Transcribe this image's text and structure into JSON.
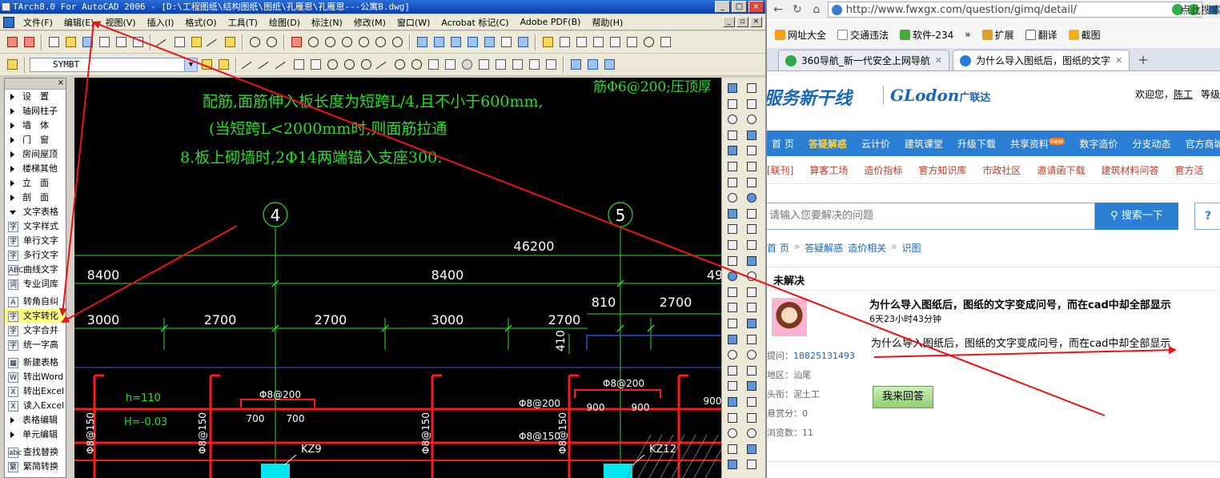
{
  "cad": {
    "title": "TArch8.0 For AutoCAD 2006 - [D:\\工程图纸\\结构图纸\\图纸\\孔雁恩\\孔雁恩---公寓B.dwg]",
    "window_buttons": [
      "_",
      "□",
      "×"
    ],
    "mdi_buttons": [
      "_",
      "▫",
      "×"
    ],
    "menu": [
      "文件(F)",
      "编辑(E)",
      "视图(V)",
      "插入(I)",
      "格式(O)",
      "工具(T)",
      "绘图(D)",
      "标注(N)",
      "修改(M)",
      "窗口(W)",
      "Acrobat 标记(C)",
      "Adobe PDF(B)",
      "帮助(H)"
    ],
    "layer_value": "SYMBT",
    "sidebar_close": "×",
    "sidebar_items": [
      {
        "label": "设　置",
        "kind": "group"
      },
      {
        "label": "轴网柱子",
        "kind": "group"
      },
      {
        "label": "墙　体",
        "kind": "group"
      },
      {
        "label": "门　窗",
        "kind": "group"
      },
      {
        "label": "房间屋顶",
        "kind": "group"
      },
      {
        "label": "楼梯其他",
        "kind": "group"
      },
      {
        "label": "立　面",
        "kind": "group"
      },
      {
        "label": "剖　面",
        "kind": "group"
      },
      {
        "label": "文字表格",
        "kind": "open"
      },
      {
        "label": "文字样式",
        "kind": "cmd",
        "glyph": "字"
      },
      {
        "label": "单行文字",
        "kind": "cmd",
        "glyph": "字"
      },
      {
        "label": "多行文字",
        "kind": "cmd",
        "glyph": "字"
      },
      {
        "label": "曲线文字",
        "kind": "cmd",
        "glyph": "ABC"
      },
      {
        "label": "专业词库",
        "kind": "cmd",
        "glyph": "词"
      },
      {
        "label": "",
        "kind": "gap"
      },
      {
        "label": "转角自纠",
        "kind": "cmd",
        "glyph": "A"
      },
      {
        "label": "文字转化",
        "kind": "cmd",
        "glyph": "字",
        "selected": true
      },
      {
        "label": "文字合并",
        "kind": "cmd",
        "glyph": "字"
      },
      {
        "label": "统一字高",
        "kind": "cmd",
        "glyph": "字"
      },
      {
        "label": "",
        "kind": "gap"
      },
      {
        "label": "新建表格",
        "kind": "cmd",
        "glyph": "▦"
      },
      {
        "label": "转出Word",
        "kind": "cmd",
        "glyph": "W"
      },
      {
        "label": "转出Excel",
        "kind": "cmd",
        "glyph": "X"
      },
      {
        "label": "读入Excel",
        "kind": "cmd",
        "glyph": "X"
      },
      {
        "label": "表格编辑",
        "kind": "group"
      },
      {
        "label": "单元编辑",
        "kind": "group"
      },
      {
        "label": "",
        "kind": "gap"
      },
      {
        "label": "查找替换",
        "kind": "cmd",
        "glyph": "abc"
      },
      {
        "label": "繁简转换",
        "kind": "cmd",
        "glyph": "繁"
      }
    ],
    "drawing": {
      "notes": [
        "配筋,面筋伸入板长度为短跨L/4,且不小于600mm,",
        "(当短跨L<2000mm时,则面筋拉通",
        "8.板上砌墙时,2Φ14两端锚入支座300."
      ],
      "note_right": "筋Φ6@200;压顶厚",
      "axis_labels": [
        "4",
        "5"
      ],
      "dims_total": "46200",
      "dims_row1": [
        "8400",
        "8400",
        "49"
      ],
      "dims_row2": [
        "3000",
        "2700",
        "2700",
        "3000",
        "2700",
        "810",
        "2700"
      ],
      "dim_vertical": "410",
      "rebar": [
        "Φ8@200",
        "Φ8@200",
        "Φ8@200",
        "Φ8@150",
        "Φ8@150",
        "Φ8@150",
        "Φ8@150",
        "Φ8@150"
      ],
      "slab": [
        "h=110",
        "H=-0.03"
      ],
      "small_dims": [
        "700",
        "700",
        "900",
        "900",
        "900"
      ],
      "columns": [
        "KZ9",
        "KZ12"
      ]
    }
  },
  "browser": {
    "url": "http://www.fwxgx.com/question/gimq/detail/",
    "search_hint": "点此搜索",
    "bookmarks": [
      "网址大全",
      "交通违法",
      "软件-234",
      "»",
      "扩展",
      "翻译",
      "截图"
    ],
    "tabs": [
      {
        "label": "360导航_新一代安全上网导航",
        "active": false
      },
      {
        "label": "为什么导入图纸后，图纸的文字",
        "active": true
      }
    ],
    "new_tab": "+",
    "logo_main": "服务新干线",
    "logo_brand": "GLodon",
    "logo_brand_cn": "广联达",
    "welcome_prefix": "欢迎您，",
    "welcome_user": "陈工",
    "welcome_suffix": "等级",
    "nav_primary": [
      "首 页",
      "答疑解惑",
      "云计价",
      "建筑课堂",
      "升级下载",
      "共享资料",
      "数字造价",
      "分支动态",
      "官方商城"
    ],
    "nav_new_badge": "new",
    "nav_secondary": [
      "[联刊]",
      "算客工场",
      "造价指标",
      "官方知识库",
      "市政社区",
      "邀请函下载",
      "建筑材料问答",
      "官方活"
    ],
    "search_placeholder": "请输入您要解决的问题",
    "search_button": "搜索一下",
    "help_button": "?",
    "breadcrumb": [
      "首 页",
      "»",
      "答疑解惑",
      "造价相关",
      "»",
      "识图"
    ],
    "question": {
      "status": "未解决",
      "title": "为什么导入图纸后，图纸的文字变成问号，而在cad中却全部显示",
      "time": "6天23小时43分钟",
      "body": "为什么导入图纸后，图纸的文字变成问号，而在cad中却全部显示",
      "asker_label": "提问：",
      "asker": "18825131493",
      "region": "地区：汕尾",
      "title_rank": "头衔：泥土工",
      "bounty": "悬赏分：0",
      "views": "浏览数：11",
      "answer_button": "我来回答"
    }
  },
  "colors": {
    "annotation": "#e8141a",
    "drawing_green": "#2bdc2b",
    "dim_white": "#ffffff",
    "rebar_red": "#ff1a1a",
    "column_cyan": "#00e5ee",
    "site_blue": "#2a7fd4"
  }
}
